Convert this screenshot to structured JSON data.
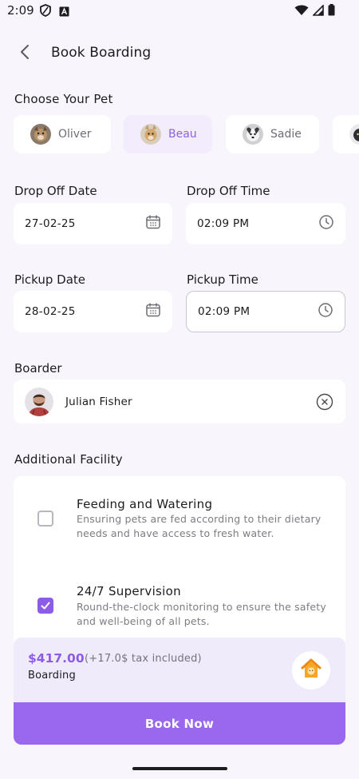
{
  "status_bar": {
    "time": "2:09",
    "left_icons": [
      "shield-icon",
      "font-icon"
    ],
    "right_icons": [
      "wifi-icon",
      "signal-icon",
      "battery-icon"
    ]
  },
  "header": {
    "title": "Book Boarding",
    "back_icon": "chevron-left-icon"
  },
  "pets_section": {
    "title": "Choose Your Pet",
    "pets": [
      {
        "name": "Oliver",
        "selected": false
      },
      {
        "name": "Beau",
        "selected": true
      },
      {
        "name": "Sadie",
        "selected": false
      },
      {
        "name": "",
        "selected": false
      }
    ]
  },
  "drop_off": {
    "date_label": "Drop Off Date",
    "date_value": "27-02-25",
    "time_label": "Drop Off Time",
    "time_value": "02:09 PM"
  },
  "pickup": {
    "date_label": "Pickup Date",
    "date_value": "28-02-25",
    "time_label": "Pickup Time",
    "time_value": "02:09 PM"
  },
  "boarder": {
    "label": "Boarder",
    "name": "Julian Fisher"
  },
  "facilities": {
    "title": "Additional Facility",
    "items": [
      {
        "title": "Feeding and Watering",
        "description": "Ensuring pets are fed according to their dietary needs and have access to fresh water.",
        "checked": false
      },
      {
        "title": "24/7 Supervision",
        "description": "Round-the-clock monitoring to ensure the safety and well-being of all pets.",
        "checked": true
      }
    ]
  },
  "summary": {
    "price": "$417.00",
    "tax_note": "(+17.0$ tax included)",
    "service": "Boarding",
    "service_icon": "pet-house-icon"
  },
  "actions": {
    "book_now": "Book Now"
  },
  "colors": {
    "accent": "#9a68ec",
    "accent_dark": "#8c5ce6",
    "background": "#f8f6fc",
    "selected_chip": "#f2ecfd"
  }
}
